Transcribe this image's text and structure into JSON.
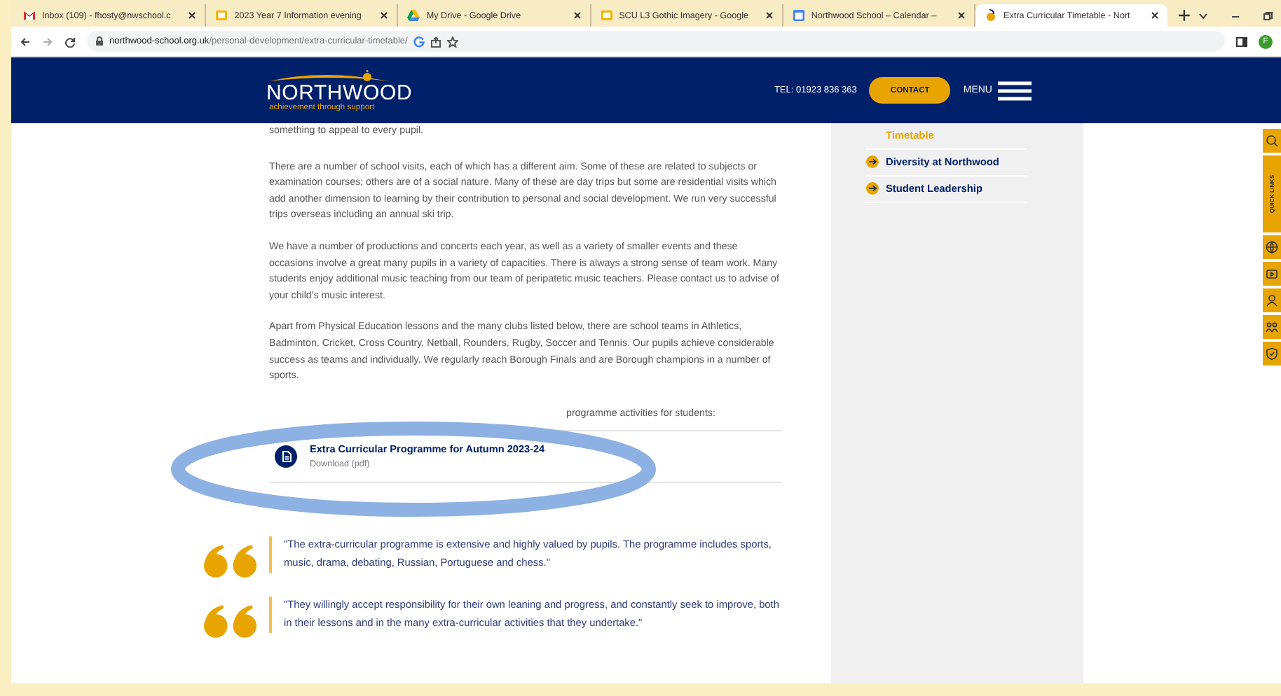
{
  "browser": {
    "tabs": [
      {
        "kind": "mail",
        "title": "Inbox (109) - fhosty@nwschool.c",
        "selected": false
      },
      {
        "kind": "slides",
        "title": "2023 Year 7 Information evening",
        "selected": false
      },
      {
        "kind": "drive",
        "title": "My Drive - Google Drive",
        "selected": false
      },
      {
        "kind": "slides",
        "title": "SCU L3 Gothic Imagery - Google",
        "selected": false
      },
      {
        "kind": "calendar",
        "title": "Northwood School – Calendar – ",
        "selected": false
      },
      {
        "kind": "school",
        "title": "Extra Curricular Timetable - Nort",
        "selected": true
      }
    ],
    "url_host": "northwood-school.org.uk",
    "url_path": "/personal-development/extra-curricular-timetable/",
    "profile_initial": "F"
  },
  "header": {
    "logo": "NORTHWOOD",
    "tagline": "achievement through support",
    "phone": "TEL: 01923 836 363",
    "contact": "CONTACT",
    "menu": "MENU"
  },
  "content": {
    "paragraphs": [
      "something to appeal to every pupil.",
      "There are a number of school visits, each of which has a different aim. Some of these are related to subjects or examination courses; others are of a social nature. Many of these are day trips but some are residential visits which add another dimension to learning by their contribution to personal and social development.  We run very successful trips overseas including an annual ski trip.",
      "We have a number of productions and concerts each year, as well as a variety of smaller events and these occasions involve a great many pupils in a variety of capacities. There is always a strong sense of team work.  Many students enjoy additional music teaching from our team of peripatetic music teachers. Please contact us to advise of your child's music interest.",
      "Apart from Physical Education lessons and the many clubs listed below, there are school teams in Athletics, Badminton, Cricket, Cross Country, Netball, Rounders, Rugby, Soccer and Tennis. Our pupils achieve considerable success as teams and individually. We regularly reach Borough Finals and are Borough champions in a number of sports."
    ],
    "partial_line": "programme activities for students:",
    "download": {
      "title": "Extra Curricular Programme for Autumn 2023-24",
      "subtitle": "Download (pdf)"
    },
    "quotes": [
      "\"The extra-curricular programme is extensive and highly valued by pupils. The programme includes sports, music, drama, debating, Russian, Portuguese and chess.\"",
      "\"They willingly accept responsibility for their own leaning and progress, and constantly seek to improve, both in their lessons and in the many extra-curricular activities that they undertake.\""
    ]
  },
  "sidebar": {
    "items": [
      {
        "label": "Timetable",
        "selected": true
      },
      {
        "label": "Diversity at Northwood",
        "selected": false
      },
      {
        "label": "Student Leadership",
        "selected": false
      }
    ]
  },
  "quick_links": {
    "label": "QUICK LINKS"
  }
}
